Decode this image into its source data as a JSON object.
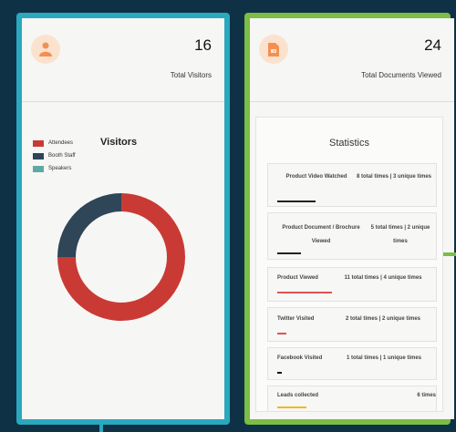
{
  "visitors_card": {
    "count": "16",
    "label": "Total Visitors",
    "icon": "person-icon",
    "icon_color": "#f3904f"
  },
  "documents_card": {
    "count": "24",
    "label": "Total Documents Viewed",
    "icon": "document-icon",
    "icon_color": "#f3904f"
  },
  "chart_data": {
    "type": "pie",
    "title": "Visitors",
    "labels": [
      "Attendees",
      "Booth Staff",
      "Speakers"
    ],
    "colors": [
      "#c93a35",
      "#2f4558",
      "#5ea9a6"
    ],
    "values": [
      12,
      4,
      0
    ]
  },
  "statistics": {
    "title": "Statistics",
    "rows": [
      {
        "name": "Product Video Watched",
        "value": "8 total times | 3 unique times",
        "bar_color": "#222222"
      },
      {
        "name": "Product Document / Brochure Viewed",
        "value": "5 total times | 2 unique times",
        "bar_color": "#222222"
      },
      {
        "name": "Product Viewed",
        "value": "11 total times | 4 unique times",
        "bar_color": "#e05252"
      },
      {
        "name": "Twitter Visited",
        "value": "2 total times | 2 unique times",
        "bar_color": "#e05252"
      },
      {
        "name": "Facebook Visited",
        "value": "1 total times | 1 unique times",
        "bar_color": "#111111"
      },
      {
        "name": "Leads collected",
        "value": "6 times",
        "bar_color": "#f0b81f"
      }
    ]
  }
}
